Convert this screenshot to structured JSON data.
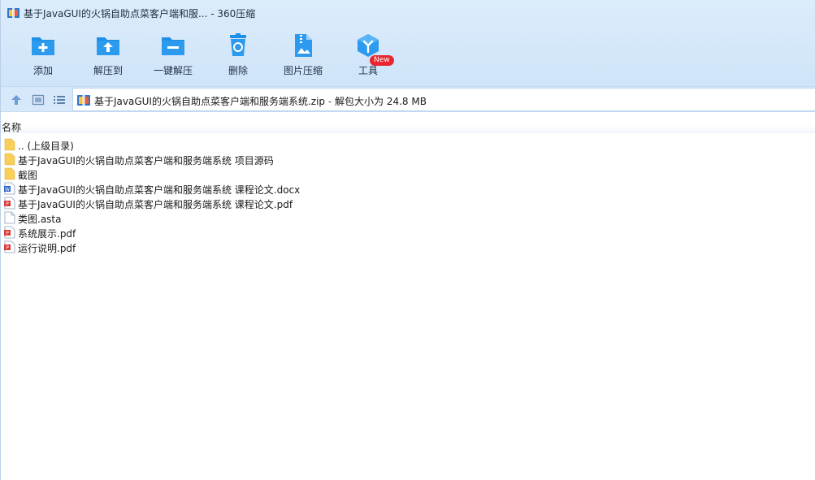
{
  "window": {
    "title": "基于JavaGUI的火锅自助点菜客户端和服... - 360压缩"
  },
  "toolbar": {
    "buttons": [
      {
        "label": "添加",
        "icon": "folder-add-icon"
      },
      {
        "label": "解压到",
        "icon": "folder-extract-icon"
      },
      {
        "label": "一键解压",
        "icon": "folder-minus-icon"
      },
      {
        "label": "删除",
        "icon": "recycle-bin-icon"
      },
      {
        "label": "图片压缩",
        "icon": "image-compress-icon"
      },
      {
        "label": "工具",
        "icon": "tools-cube-icon"
      }
    ],
    "new_badge": "New"
  },
  "address": {
    "archive_name": "基于JavaGUI的火锅自助点菜客户端和服务端系统.zip",
    "separator": " - ",
    "info": "解包大小为 24.8 MB"
  },
  "list": {
    "column_name": "名称",
    "items": [
      {
        "name": ".. (上级目录)",
        "type": "folder"
      },
      {
        "name": "基于JavaGUI的火锅自助点菜客户端和服务端系统 项目源码",
        "type": "folder"
      },
      {
        "name": "截图",
        "type": "folder"
      },
      {
        "name": "基于JavaGUI的火锅自助点菜客户端和服务端系统 课程论文.docx",
        "type": "docx"
      },
      {
        "name": "基于JavaGUI的火锅自助点菜客户端和服务端系统 课程论文.pdf",
        "type": "pdf"
      },
      {
        "name": "类图.asta",
        "type": "file"
      },
      {
        "name": "系统展示.pdf",
        "type": "pdf"
      },
      {
        "name": "运行说明.pdf",
        "type": "pdf"
      }
    ]
  },
  "colors": {
    "accent_blue": "#1e8fe6",
    "folder_yellow": "#f7cf5a",
    "pdf_red": "#d93a3a",
    "docx_blue": "#2b66c9"
  }
}
